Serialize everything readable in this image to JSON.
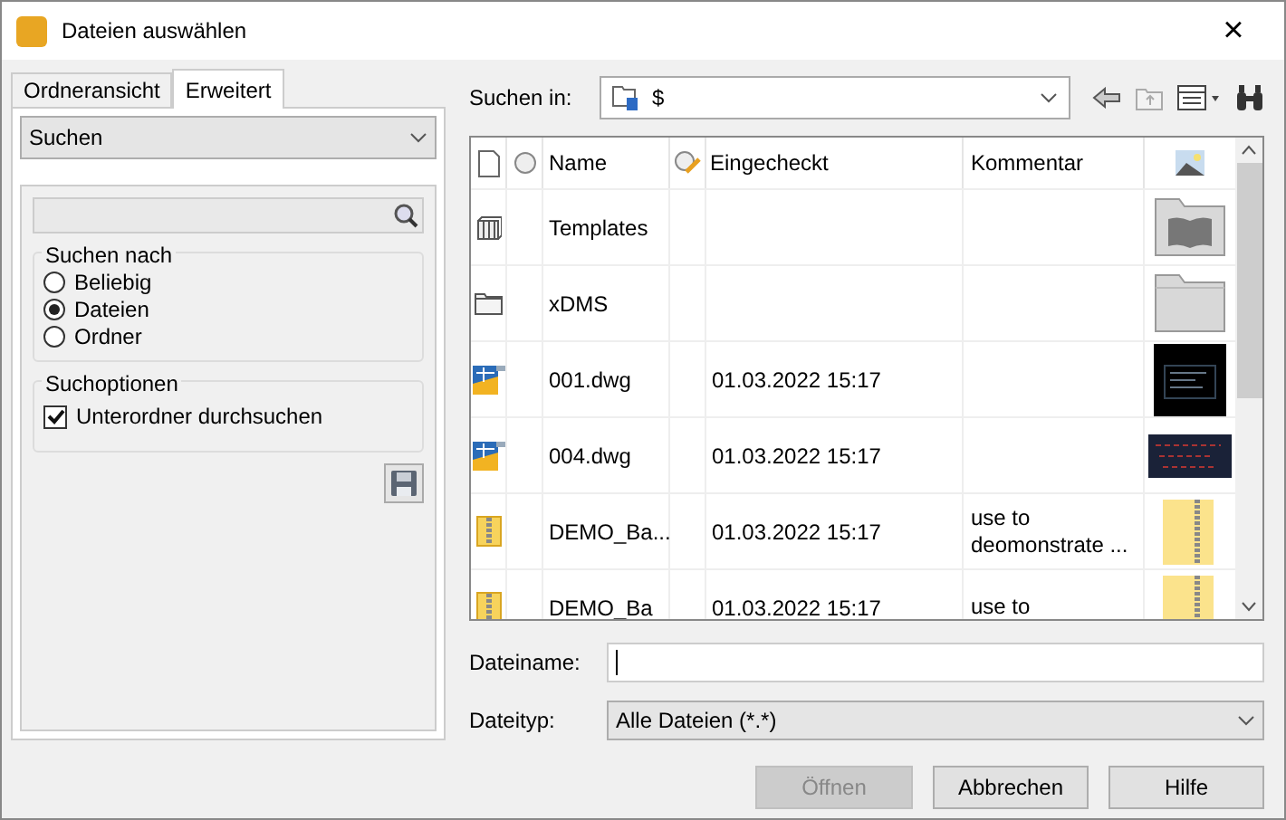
{
  "window": {
    "title": "Dateien auswählen",
    "close": "×"
  },
  "tabs": [
    {
      "label": "Ordneransicht",
      "selected": false
    },
    {
      "label": "Erweitert",
      "selected": true
    }
  ],
  "mode_select": {
    "value": "Suchen"
  },
  "search_for": {
    "title": "Suchen nach",
    "options": [
      {
        "label": "Beliebig",
        "selected": false
      },
      {
        "label": "Dateien",
        "selected": true
      },
      {
        "label": "Ordner",
        "selected": false
      }
    ]
  },
  "search_options": {
    "title": "Suchoptionen",
    "items": [
      {
        "label": "Unterordner durchsuchen",
        "checked": true
      }
    ]
  },
  "look_in": {
    "label": "Suchen in:",
    "value": "$"
  },
  "table": {
    "columns": [
      "Name",
      "Eingecheckt",
      "Kommentar"
    ],
    "rows": [
      {
        "kind": "library",
        "name": "Templates"
      },
      {
        "kind": "folder",
        "name": "xDMS"
      },
      {
        "kind": "drawing",
        "name": "001.dwg",
        "checked_in": "01.03.2022 15:17"
      },
      {
        "kind": "drawing",
        "name": "004.dwg",
        "checked_in": "01.03.2022 15:17"
      },
      {
        "kind": "archive",
        "name": "DEMO_Ba...",
        "checked_in": "01.03.2022 15:17",
        "comment": [
          "use to",
          "deomonstrate ..."
        ]
      },
      {
        "kind": "archive",
        "name": "DEMO_Ba",
        "checked_in": "01.03.2022 15:17",
        "comment": [
          "use to"
        ]
      }
    ]
  },
  "filename": {
    "label": "Dateiname:"
  },
  "filetype": {
    "label": "Dateityp:",
    "value": "Alle Dateien (*.*)"
  },
  "buttons": [
    {
      "label": "Öffnen",
      "disabled": true
    },
    {
      "label": "Abbrechen",
      "disabled": false
    },
    {
      "label": "Hilfe",
      "disabled": false
    }
  ]
}
